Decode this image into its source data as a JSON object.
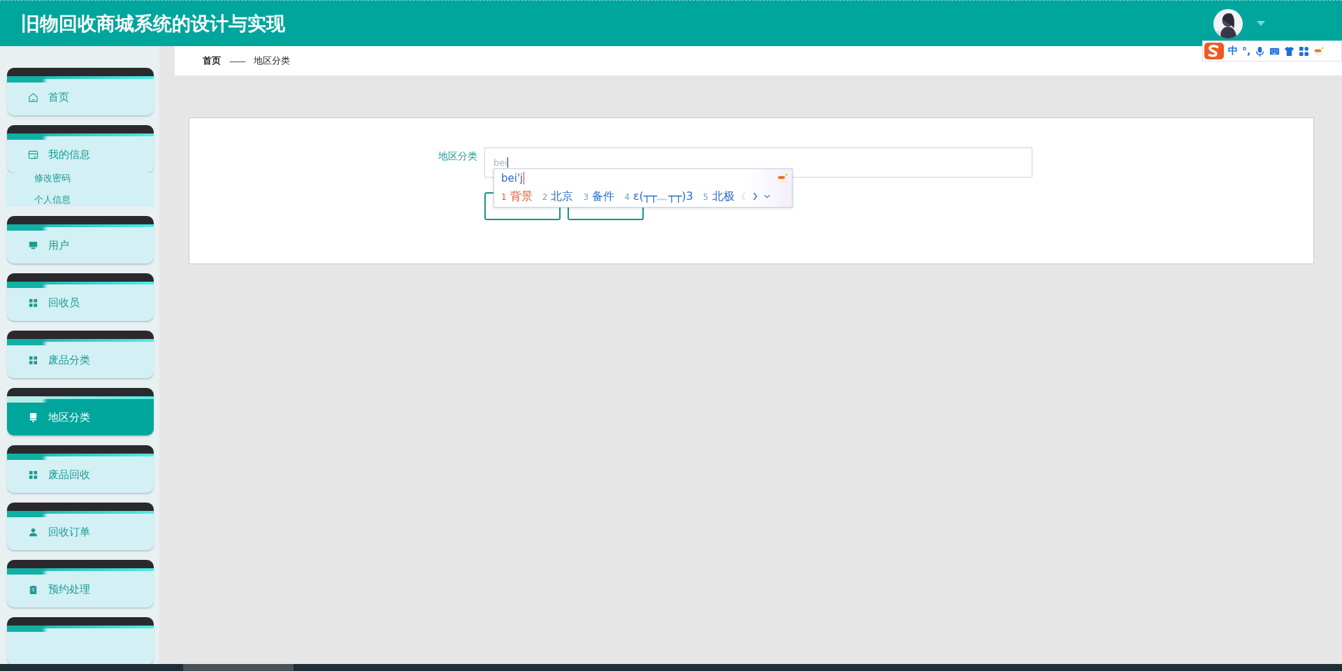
{
  "header": {
    "title": "旧物回收商城系统的设计与实现"
  },
  "ime_toolbar": {
    "mode": "中",
    "punctuation": "°,"
  },
  "sidebar": {
    "items": [
      {
        "label": "首页",
        "selected": false
      },
      {
        "label": "我的信息",
        "selected": false,
        "expanded": true,
        "children": [
          {
            "label": "修改密码"
          },
          {
            "label": "个人信息"
          }
        ]
      },
      {
        "label": "用户",
        "selected": false
      },
      {
        "label": "回收员",
        "selected": false
      },
      {
        "label": "废品分类",
        "selected": false
      },
      {
        "label": "地区分类",
        "selected": true
      },
      {
        "label": "废品回收",
        "selected": false
      },
      {
        "label": "回收订单",
        "selected": false
      },
      {
        "label": "预约处理",
        "selected": false
      }
    ]
  },
  "breadcrumb": {
    "items": [
      "首页",
      "地区分类"
    ],
    "separator": "——"
  },
  "form": {
    "label": "地区分类",
    "value": "bei"
  },
  "ime_popup": {
    "composition": "bei'j",
    "candidates": [
      {
        "index": "1",
        "text": "背景",
        "selected": true
      },
      {
        "index": "2",
        "text": "北京",
        "selected": false
      },
      {
        "index": "3",
        "text": "备件",
        "selected": false
      },
      {
        "index": "4",
        "text": "ε(┬┬﹏┬┬)3",
        "selected": false
      },
      {
        "index": "5",
        "text": "北极",
        "selected": false
      }
    ]
  }
}
